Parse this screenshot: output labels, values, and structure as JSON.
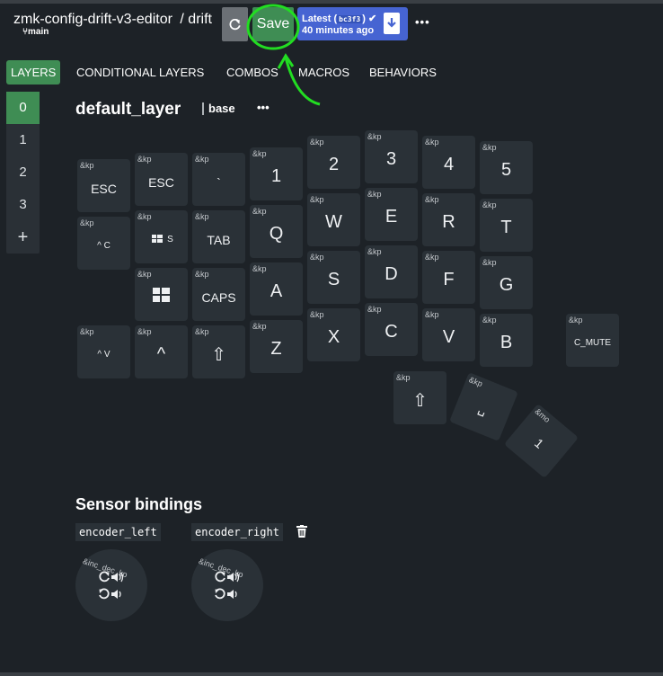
{
  "header": {
    "repo": "zmk-config-drift-v3-editor",
    "separator": "/",
    "keyboard": "drift",
    "branch": "main",
    "save_label": "Save",
    "latest_prefix": "Latest (",
    "latest_commit": "bc3f3",
    "latest_suffix": ")",
    "latest_time": "40 minutes ago",
    "more": "•••",
    "colors": {
      "save": "#3f8d54",
      "latest": "#4664d2",
      "refresh": "#6b7075"
    }
  },
  "tabs": [
    "LAYERS",
    "CONDITIONAL LAYERS",
    "COMBOS",
    "MACROS",
    "BEHAVIORS"
  ],
  "layers": {
    "items": [
      "0",
      "1",
      "2",
      "3"
    ],
    "add": "+"
  },
  "layer_header": {
    "name": "default_layer",
    "tag": "base",
    "more": "•••"
  },
  "keys": [
    {
      "b": "&kp",
      "l": "ESC"
    },
    {
      "b": "&kp",
      "l": "ESC"
    },
    {
      "b": "&kp",
      "l": "`"
    },
    {
      "b": "&kp",
      "l": "1"
    },
    {
      "b": "&kp",
      "l": "2"
    },
    {
      "b": "&kp",
      "l": "3"
    },
    {
      "b": "&kp",
      "l": "4"
    },
    {
      "b": "&kp",
      "l": "5"
    },
    {
      "b": "&kp",
      "l": "^ C"
    },
    {
      "b": "&kp",
      "l": "S"
    },
    {
      "b": "&kp",
      "l": "TAB"
    },
    {
      "b": "&kp",
      "l": "Q"
    },
    {
      "b": "&kp",
      "l": "W"
    },
    {
      "b": "&kp",
      "l": "E"
    },
    {
      "b": "&kp",
      "l": "R"
    },
    {
      "b": "&kp",
      "l": "T"
    },
    {
      "b": "&kp",
      "l": ""
    },
    {
      "b": "&kp",
      "l": "CAPS"
    },
    {
      "b": "&kp",
      "l": "A"
    },
    {
      "b": "&kp",
      "l": "S"
    },
    {
      "b": "&kp",
      "l": "D"
    },
    {
      "b": "&kp",
      "l": "F"
    },
    {
      "b": "&kp",
      "l": "G"
    },
    {
      "b": "&kp",
      "l": "^ V"
    },
    {
      "b": "&kp",
      "l": "^"
    },
    {
      "b": "&kp",
      "l": "⇧"
    },
    {
      "b": "&kp",
      "l": "Z"
    },
    {
      "b": "&kp",
      "l": "X"
    },
    {
      "b": "&kp",
      "l": "C"
    },
    {
      "b": "&kp",
      "l": "V"
    },
    {
      "b": "&kp",
      "l": "B"
    },
    {
      "b": "&kp",
      "l": "C_MUTE"
    },
    {
      "b": "&kp",
      "l": "⇧"
    },
    {
      "b": "&kp",
      "l": "␣"
    },
    {
      "b": "&mo",
      "l": "1"
    }
  ],
  "sensors": {
    "title": "Sensor bindings",
    "items": [
      {
        "name": "encoder_left",
        "binding": "&inc_dec_kp"
      },
      {
        "name": "encoder_right",
        "binding": "&inc_dec_kp"
      }
    ]
  }
}
